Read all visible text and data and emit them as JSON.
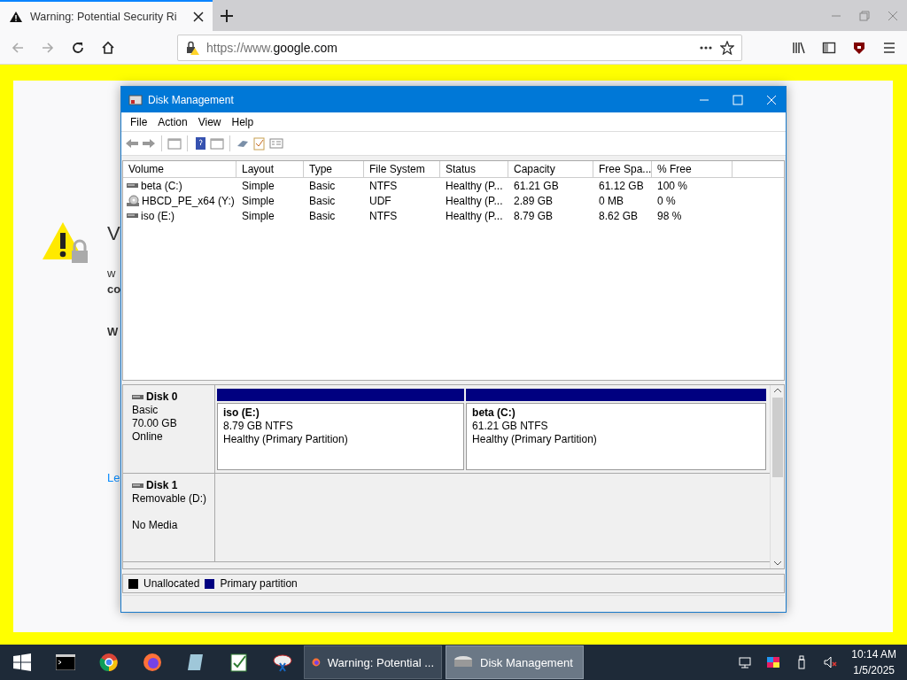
{
  "browser": {
    "tab_title": "Warning: Potential Security Ri",
    "url_prefix": "https://www.",
    "url_domain": "google.com"
  },
  "page": {
    "heading": "V",
    "line_1": "w",
    "line_2": "co",
    "line_3": "W",
    "link": "Le"
  },
  "disk_management": {
    "title": "Disk Management",
    "menu": [
      "File",
      "Action",
      "View",
      "Help"
    ],
    "columns": [
      "Volume",
      "Layout",
      "Type",
      "File System",
      "Status",
      "Capacity",
      "Free Spa...",
      "% Free"
    ],
    "rows": [
      {
        "kind": "disk",
        "cells": [
          "beta (C:)",
          "Simple",
          "Basic",
          "NTFS",
          "Healthy (P...",
          "61.21 GB",
          "61.12 GB",
          "100 %"
        ]
      },
      {
        "kind": "optical",
        "cells": [
          "HBCD_PE_x64 (Y:)",
          "Simple",
          "Basic",
          "UDF",
          "Healthy (P...",
          "2.89 GB",
          "0 MB",
          "0 %"
        ]
      },
      {
        "kind": "disk",
        "cells": [
          "iso (E:)",
          "Simple",
          "Basic",
          "NTFS",
          "Healthy (P...",
          "8.79 GB",
          "8.62 GB",
          "98 %"
        ]
      }
    ],
    "disks": [
      {
        "name": "Disk 0",
        "type": "Basic",
        "capacity": "70.00 GB",
        "status": "Online",
        "partitions": [
          {
            "name": "iso  (E:)",
            "size": "8.79 GB NTFS",
            "status": "Healthy (Primary Partition)",
            "color": "#000080"
          },
          {
            "name": "beta  (C:)",
            "size": "61.21 GB NTFS",
            "status": "Healthy (Primary Partition)",
            "color": "#000080"
          }
        ]
      },
      {
        "name": "Disk 1",
        "type": "Removable (D:)",
        "status": "No Media"
      }
    ],
    "legend": [
      {
        "label": "Unallocated",
        "color": "#000000"
      },
      {
        "label": "Primary partition",
        "color": "#000080"
      }
    ]
  },
  "taskbar": {
    "windows": [
      {
        "label": "Warning: Potential ...",
        "kind": "firefox",
        "selected": false
      },
      {
        "label": "Disk Management",
        "kind": "disk",
        "selected": true
      }
    ],
    "time": "10:14 AM",
    "date": "1/5/2025"
  }
}
